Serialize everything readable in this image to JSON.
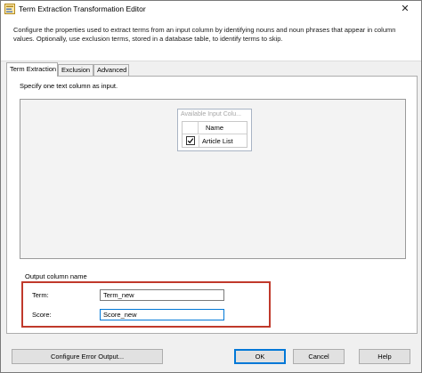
{
  "window": {
    "title": "Term Extraction Transformation Editor",
    "close_glyph": "✕",
    "app_icon": "ssis-transform-icon"
  },
  "description": "Configure the properties used to extract terms from an input column by identifying nouns and noun phrases that appear in column values. Optionally, use exclusion terms, stored in a database table, to identify terms to skip.",
  "tabs": [
    {
      "label": "Term Extraction",
      "active": true
    },
    {
      "label": "Exclusion",
      "active": false
    },
    {
      "label": "Advanced",
      "active": false
    }
  ],
  "instruction": "Specify one text column as input.",
  "input_columns": {
    "header": "Available Input Colu...",
    "column_header": "Name",
    "rows": [
      {
        "checked": true,
        "label": "Article List"
      }
    ]
  },
  "output": {
    "group_title": "Output column name",
    "term_label": "Term:",
    "term_value": "Term_new",
    "score_label": "Score:",
    "score_value": "Score_new"
  },
  "buttons": {
    "configure_error_output": "Configure Error Output...",
    "ok": "OK",
    "cancel": "Cancel",
    "help": "Help"
  },
  "colors": {
    "highlight_border": "#c0392b",
    "focus_border": "#0078d7"
  }
}
